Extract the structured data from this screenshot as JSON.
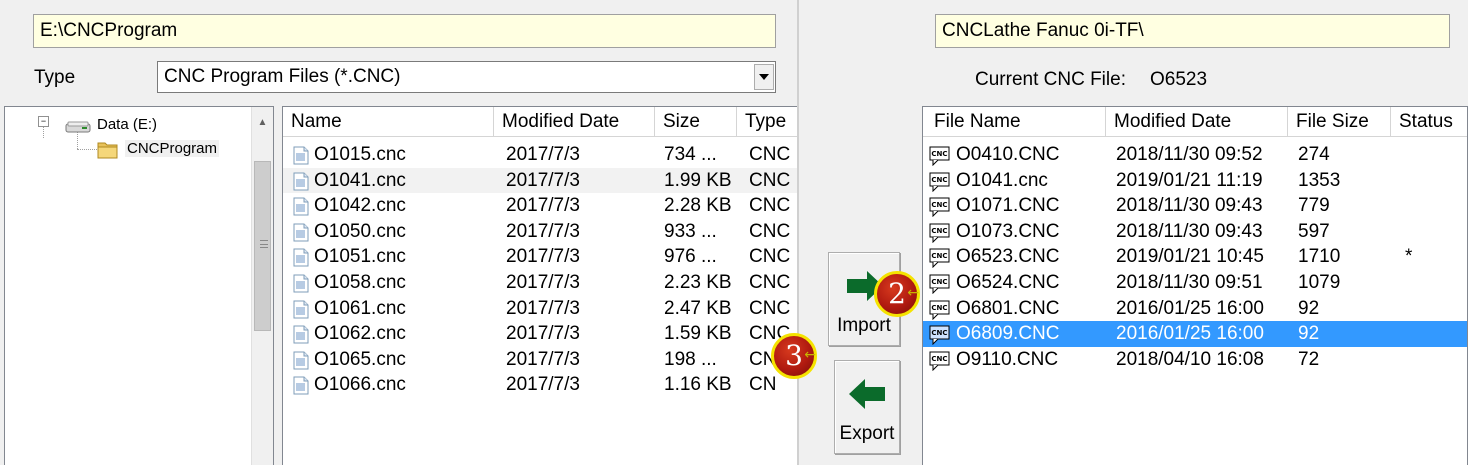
{
  "local": {
    "path": "E:\\CNCProgram",
    "type_label": "Type",
    "type_value": "CNC Program Files (*.CNC)",
    "tree": [
      {
        "label": "Data (E:)",
        "expander": "⊟"
      },
      {
        "label": "CNCProgram"
      }
    ],
    "columns": [
      "Name",
      "Modified Date",
      "Size",
      "Type"
    ],
    "files": [
      {
        "name": "O1015.cnc",
        "date": "2017/7/3",
        "size": "734 ...",
        "type": "CNC"
      },
      {
        "name": "O1041.cnc",
        "date": "2017/7/3",
        "size": "1.99 KB",
        "type": "CNC"
      },
      {
        "name": "O1042.cnc",
        "date": "2017/7/3",
        "size": "2.28 KB",
        "type": "CNC"
      },
      {
        "name": "O1050.cnc",
        "date": "2017/7/3",
        "size": "933 ...",
        "type": "CNC"
      },
      {
        "name": "O1051.cnc",
        "date": "2017/7/3",
        "size": "976 ...",
        "type": "CNC"
      },
      {
        "name": "O1058.cnc",
        "date": "2017/7/3",
        "size": "2.23 KB",
        "type": "CNC"
      },
      {
        "name": "O1061.cnc",
        "date": "2017/7/3",
        "size": "2.47 KB",
        "type": "CNC"
      },
      {
        "name": "O1062.cnc",
        "date": "2017/7/3",
        "size": "1.59 KB",
        "type": "CNC"
      },
      {
        "name": "O1065.cnc",
        "date": "2017/7/3",
        "size": "198 ...",
        "type": "CN"
      },
      {
        "name": "O1066.cnc",
        "date": "2017/7/3",
        "size": "1.16 KB",
        "type": "CN"
      }
    ]
  },
  "buttons": {
    "import_label": "Import",
    "export_label": "Export"
  },
  "callouts": [
    "2",
    "3"
  ],
  "remote": {
    "path": "CNCLathe Fanuc 0i-TF\\",
    "current_label": "Current CNC File:",
    "current_value": "O6523",
    "columns": [
      "File Name",
      "Modified Date",
      "File Size",
      "Status"
    ],
    "files": [
      {
        "name": "O0410.CNC",
        "date": "2018/11/30 09:52",
        "size": "274",
        "status": ""
      },
      {
        "name": "O1041.cnc",
        "date": "2019/01/21 11:19",
        "size": "1353",
        "status": ""
      },
      {
        "name": "O1071.CNC",
        "date": "2018/11/30 09:43",
        "size": "779",
        "status": ""
      },
      {
        "name": "O1073.CNC",
        "date": "2018/11/30 09:43",
        "size": "597",
        "status": ""
      },
      {
        "name": "O6523.CNC",
        "date": "2019/01/21 10:45",
        "size": "1710",
        "status": "*"
      },
      {
        "name": "O6524.CNC",
        "date": "2018/11/30 09:51",
        "size": "1079",
        "status": ""
      },
      {
        "name": "O6801.CNC",
        "date": "2016/01/25 16:00",
        "size": "92",
        "status": ""
      },
      {
        "name": "O6809.CNC",
        "date": "2016/01/25 16:00",
        "size": "92",
        "status": ""
      },
      {
        "name": "O9110.CNC",
        "date": "2018/04/10 16:08",
        "size": "72",
        "status": ""
      }
    ],
    "selected_index": 7,
    "icon_text": "CNC"
  },
  "colors": {
    "selection": "#3399ff",
    "path_bg": "#ffffe1",
    "arrow_green": "#0b6b2b",
    "callout_red": "#b01a10",
    "callout_ring": "#f5e300"
  },
  "icons": {
    "drive": "drive-icon",
    "folder": "folder-icon",
    "file": "document-icon",
    "cnc_file": "cnc-file-icon",
    "import": "arrow-right-icon",
    "export": "arrow-left-icon"
  }
}
